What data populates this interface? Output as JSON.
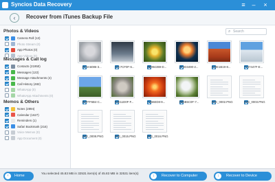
{
  "window": {
    "title": "Syncios Data Recovery"
  },
  "header": {
    "title": "Recover from iTunes Backup File"
  },
  "sidebar": {
    "sections": [
      {
        "title": "Photos & Videos",
        "items": [
          {
            "label": "Camera Roll (13)",
            "checked": true,
            "enabled": true,
            "active": false,
            "icon": "camera-icon",
            "color": "#3a8ee6"
          },
          {
            "label": "Photo Stream (0)",
            "checked": false,
            "enabled": false,
            "active": false,
            "icon": "photostream-icon",
            "color": "#9fb7d4"
          },
          {
            "label": "App Photos (0)",
            "checked": true,
            "enabled": true,
            "active": false,
            "icon": "app-photos-icon",
            "color": "#e24a3b"
          },
          {
            "label": "App Videos (0)",
            "checked": false,
            "enabled": false,
            "active": false,
            "icon": "app-videos-icon",
            "color": "#b6c2cf"
          }
        ]
      },
      {
        "title": "Messages & Call log",
        "items": [
          {
            "label": "Contacts (21950)",
            "checked": true,
            "enabled": true,
            "active": false,
            "icon": "contacts-icon",
            "color": "#7b8ea3"
          },
          {
            "label": "Messages (122)",
            "checked": true,
            "enabled": true,
            "active": false,
            "icon": "messages-icon",
            "color": "#49b84b"
          },
          {
            "label": "Message Attachments (4)",
            "checked": true,
            "enabled": true,
            "active": false,
            "icon": "attachment-icon",
            "color": "#49b84b"
          },
          {
            "label": "Call History (482)",
            "checked": true,
            "enabled": true,
            "active": false,
            "icon": "phone-icon",
            "color": "#49b84b"
          },
          {
            "label": "WhatsApp (0)",
            "checked": false,
            "enabled": false,
            "active": false,
            "icon": "whatsapp-icon",
            "color": "#a5d6a7"
          },
          {
            "label": "WhatsApp Attachments (0)",
            "checked": false,
            "enabled": false,
            "active": false,
            "icon": "whatsapp-attachment-icon",
            "color": "#a5d6a7"
          }
        ]
      },
      {
        "title": "Memos & Others",
        "items": [
          {
            "label": "Notes (2894)",
            "checked": true,
            "enabled": true,
            "active": false,
            "icon": "notes-icon",
            "color": "#f2c13a"
          },
          {
            "label": "Calendar (1627)",
            "checked": true,
            "enabled": true,
            "active": false,
            "icon": "calendar-icon",
            "color": "#e9554a"
          },
          {
            "label": "Reminders (1)",
            "checked": true,
            "enabled": true,
            "active": false,
            "icon": "reminders-icon",
            "color": "#e9e9e9"
          },
          {
            "label": "Safari Bookmark (216)",
            "checked": true,
            "enabled": true,
            "active": false,
            "icon": "safari-icon",
            "color": "#3a8ee6"
          },
          {
            "label": "Voice Memos (0)",
            "checked": false,
            "enabled": false,
            "active": false,
            "icon": "voice-memo-icon",
            "color": "#c7cdd4"
          },
          {
            "label": "App Document (0)",
            "checked": false,
            "enabled": false,
            "active": false,
            "icon": "app-document-icon",
            "color": "#c7cdd4"
          }
        ]
      }
    ]
  },
  "search": {
    "placeholder": "Search"
  },
  "thumbnails": [
    {
      "name": "0C6A6086-3...",
      "kind": "photo-gray",
      "checked": true
    },
    {
      "name": "10C7CF0F-6...",
      "kind": "photo-phone",
      "checked": true
    },
    {
      "name": "2B9942B9-D...",
      "kind": "photo-flower",
      "checked": true
    },
    {
      "name": "3F3D3490-2...",
      "kind": "photo-jellyfish",
      "checked": true
    },
    {
      "name": "640E1B19-8...",
      "kind": "photo-desert",
      "checked": true
    },
    {
      "name": "7247447F-E...",
      "kind": "photo-penguins",
      "checked": true
    },
    {
      "name": "84FFF6B4-C...",
      "kind": "photo-lighthouse",
      "checked": true
    },
    {
      "name": "83E11D0F-F...",
      "kind": "photo-koala",
      "checked": true
    },
    {
      "name": "A1B6ED8-9...",
      "kind": "photo-chrysanthemum",
      "checked": true
    },
    {
      "name": "B66B5C0F-7...",
      "kind": "photo-hydrangea",
      "checked": true
    },
    {
      "name": "IMG_0002.PNG",
      "kind": "doc",
      "checked": true
    },
    {
      "name": "IMG_0003.PNG",
      "kind": "doc",
      "checked": true
    },
    {
      "name": "IMG_0008.PNG",
      "kind": "doc",
      "checked": true
    },
    {
      "name": "IMG_0015.PNG",
      "kind": "doc",
      "checked": true
    },
    {
      "name": "IMG_0016.PNG",
      "kind": "doc",
      "checked": true
    }
  ],
  "footer": {
    "home_label": "Home",
    "status_text": "You selected 45.83 MB in 32531 item(s) of 45.83 MB in 32531 item(s)",
    "recover_computer_label": "Recover to Computer",
    "recover_device_label": "Recover to Device"
  },
  "colors": {
    "accent": "#2b8fd8"
  }
}
